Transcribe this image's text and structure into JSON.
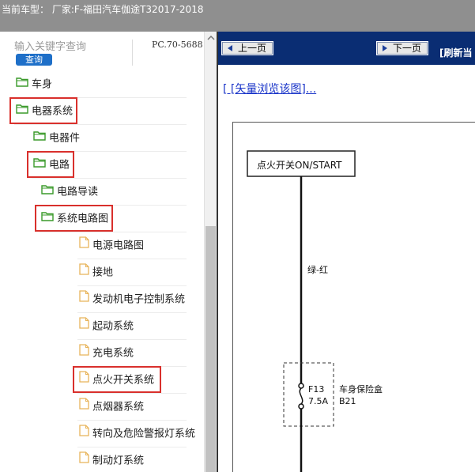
{
  "window": {
    "title": "当前车型：  厂家:F-福田汽车伽途T32017-2018"
  },
  "search": {
    "placeholder": "输入关键字查询",
    "button_label": "查询",
    "code": "PC.70-5688"
  },
  "tree": [
    {
      "label": "车身",
      "type": "folder",
      "level": 0
    },
    {
      "label": "电器系统",
      "type": "folder",
      "level": 0,
      "highlighted": true
    },
    {
      "label": "电器件",
      "type": "folder",
      "level": 1
    },
    {
      "label": "电路",
      "type": "folder",
      "level": 1,
      "highlighted": true
    },
    {
      "label": "电路导读",
      "type": "folder",
      "level": 2
    },
    {
      "label": "系统电路图",
      "type": "folder",
      "level": 2,
      "highlighted": true
    },
    {
      "label": "电源电路图",
      "type": "page",
      "level": 3
    },
    {
      "label": "接地",
      "type": "page",
      "level": 3
    },
    {
      "label": "发动机电子控制系统",
      "type": "page",
      "level": 3
    },
    {
      "label": "起动系统",
      "type": "page",
      "level": 3
    },
    {
      "label": "充电系统",
      "type": "page",
      "level": 3
    },
    {
      "label": "点火开关系统",
      "type": "page",
      "level": 3,
      "highlighted": true
    },
    {
      "label": "点烟器系统",
      "type": "page",
      "level": 3
    },
    {
      "label": "转向及危险警报灯系统",
      "type": "page",
      "level": 3
    },
    {
      "label": "制动灯系统",
      "type": "page",
      "level": 3
    }
  ],
  "toolbar": {
    "prev_label": "上一页",
    "next_label": "下一页",
    "refresh_label": "[刷新当"
  },
  "viewer": {
    "vector_link": "[ [矢量浏览该图]..."
  },
  "diagram": {
    "switch_label": "点火开关ON/START",
    "wire_label": "绿-红",
    "fuse_id": "F13",
    "fuse_rating": "7.5A",
    "box_name": "车身保险盒",
    "box_code": "B21"
  },
  "colors": {
    "toolbar_bg": "#0a2d73",
    "highlight": "#d9302c",
    "folder_icon": "#3a9a2a",
    "link": "#1a35c9"
  }
}
